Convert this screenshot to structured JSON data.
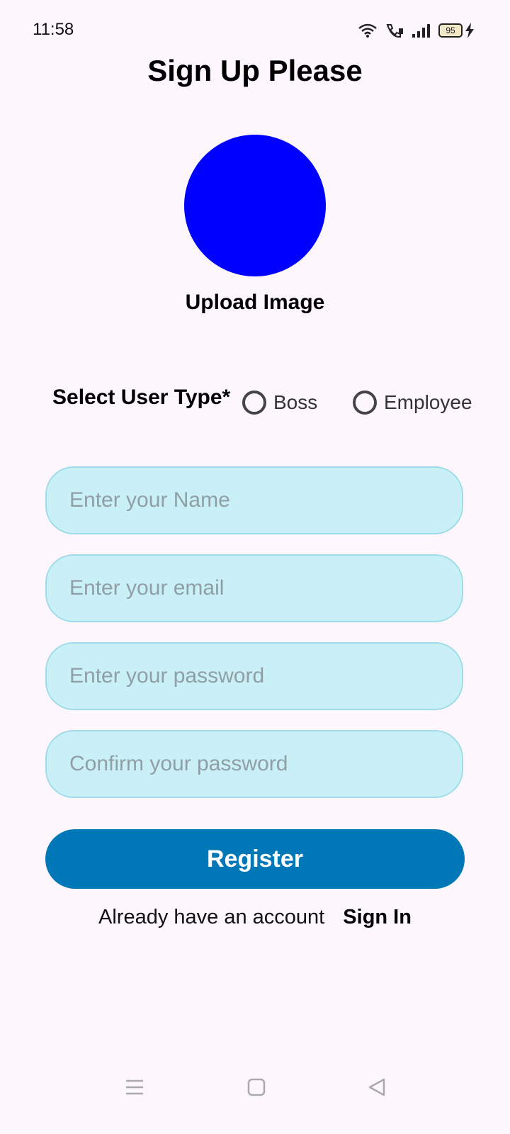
{
  "status_bar": {
    "time": "11:58",
    "battery": "95",
    "icons": [
      "wifi-icon",
      "call-icon",
      "signal-icon",
      "battery-icon",
      "charging-icon"
    ]
  },
  "page": {
    "title": "Sign Up Please"
  },
  "avatar": {
    "color": "#0000ff",
    "upload_label": "Upload Image"
  },
  "user_type": {
    "label": "Select User Type*",
    "options": [
      "Boss",
      "Employee"
    ]
  },
  "form": {
    "name_placeholder": "Enter your Name",
    "email_placeholder": "Enter your email",
    "password_placeholder": "Enter your password",
    "confirm_placeholder": "Confirm your password",
    "register_label": "Register"
  },
  "signin": {
    "prompt": "Already have an account",
    "link_label": "Sign In"
  },
  "colors": {
    "background": "#fdf6fd",
    "field_bg": "#c9f0f6",
    "accent": "#0077b6"
  },
  "nav": {
    "icons": [
      "menu-icon",
      "home-icon",
      "back-icon"
    ]
  }
}
